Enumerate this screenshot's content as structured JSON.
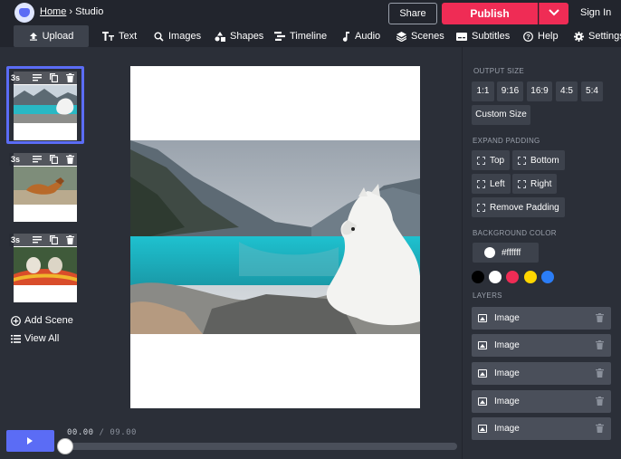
{
  "header": {
    "home_link": "Home",
    "separator": "›",
    "title": "Studio",
    "share_label": "Share",
    "publish_label": "Publish",
    "signin_label": "Sign In"
  },
  "toolbar": {
    "upload": "Upload",
    "text": "Text",
    "images": "Images",
    "shapes": "Shapes",
    "timeline": "Timeline",
    "audio": "Audio",
    "scenes": "Scenes",
    "subtitles": "Subtitles",
    "help": "Help",
    "settings": "Settings"
  },
  "scenes": {
    "items": [
      {
        "duration": "3s",
        "image": "lake-with-white-dog",
        "selected": true
      },
      {
        "duration": "3s",
        "image": "brown-dog-running"
      },
      {
        "duration": "3s",
        "image": "dogs-in-hammock"
      }
    ],
    "add_scene": "Add Scene",
    "view_all": "View All"
  },
  "player": {
    "current_time": "00.00",
    "separator": "/",
    "total_time": "09.00",
    "progress": 0
  },
  "panel": {
    "output_size_label": "OUTPUT SIZE",
    "ratios": [
      "1:1",
      "9:16",
      "16:9",
      "4:5",
      "5:4"
    ],
    "custom_size": "Custom Size",
    "expand_padding_label": "EXPAND PADDING",
    "padding_top": "Top",
    "padding_bottom": "Bottom",
    "padding_left": "Left",
    "padding_right": "Right",
    "remove_padding": "Remove Padding",
    "background_color_label": "BACKGROUND COLOR",
    "background_color_value": "#ffffff",
    "swatches": [
      "#000000",
      "#ffffff",
      "#ef2c55",
      "#ffd600",
      "#2b7df6"
    ],
    "layers_label": "LAYERS",
    "layers": [
      "Image",
      "Image",
      "Image",
      "Image",
      "Image"
    ]
  },
  "colors": {
    "accent": "#5b6cf5",
    "publish": "#ef2c55",
    "background": "#2b2f38"
  }
}
